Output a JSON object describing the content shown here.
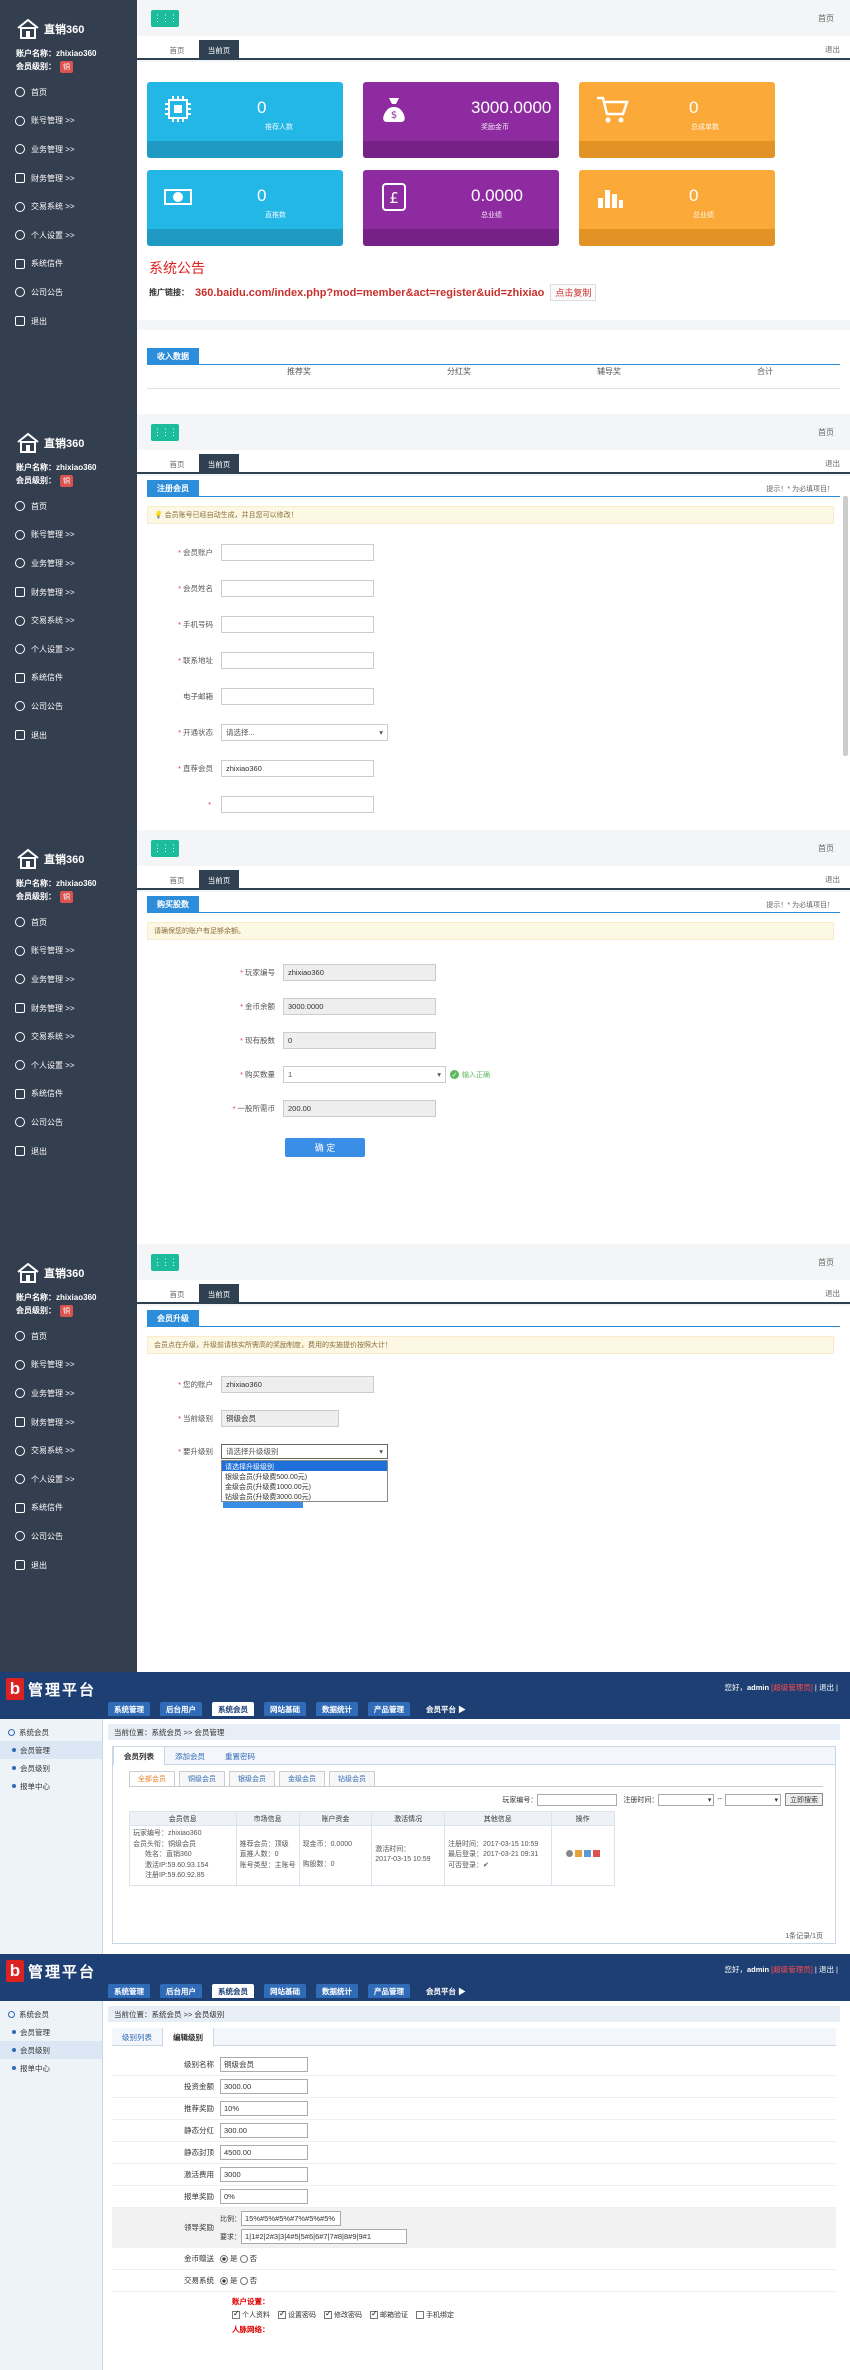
{
  "app": {
    "logo_text": "直销360",
    "account_label": "账户名称：",
    "account_value": "zhixiao360",
    "level_label": "会员级别：",
    "level_badge": "铜",
    "menu": [
      "首页",
      "账号管理 >>",
      "业务管理 >>",
      "财务管理 >>",
      "交易系统 >>",
      "个人设置 >>",
      "系统信件",
      "公司公告",
      "退出"
    ],
    "toggle_icon": "⋮⋮⋮",
    "home_link": "首页",
    "tab_home": "首页",
    "tab_current": "当前页",
    "close_link": "退出"
  },
  "dashboard": {
    "cards": [
      {
        "value": "0",
        "label": "推荐人数",
        "icon": "chip-icon",
        "color": "#23b7e5"
      },
      {
        "value": "3000.0000",
        "label": "奖励金币",
        "icon": "money-bag-icon",
        "color": "#8e2ba1"
      },
      {
        "value": "0",
        "label": "总成单数",
        "icon": "cart-icon",
        "color": "#fbaa3a"
      },
      {
        "value": "0",
        "label": "直推数",
        "icon": "world-money-icon",
        "color": "#23b7e5"
      },
      {
        "value": "0.0000",
        "label": "总业绩",
        "icon": "pound-icon",
        "color": "#8e2ba1"
      },
      {
        "value": "0",
        "label": "总业绩",
        "icon": "bar-chart-icon",
        "color": "#fbaa3a"
      }
    ],
    "announcement_title": "系统公告",
    "promo_label": "推广链接：",
    "promo_url": "360.baidu.com/index.php?mod=member&act=register&uid=zhixiao",
    "copy_button": "点击复制",
    "income_title": "收入数据",
    "income_columns": [
      "推荐奖",
      "分红奖",
      "辅导奖",
      "合计"
    ]
  },
  "register": {
    "section_title": "注册会员",
    "crumb": "提示！* 为必填项目！",
    "notice": "💡 会员账号已经自动生成，并且您可以修改！",
    "fields": [
      {
        "label": "会员账户",
        "required": true,
        "value": ""
      },
      {
        "label": "会员姓名",
        "required": true,
        "value": ""
      },
      {
        "label": "手机号码",
        "required": true,
        "value": ""
      },
      {
        "label": "联系地址",
        "required": true,
        "value": ""
      },
      {
        "label": "电子邮箱",
        "required": false,
        "value": ""
      },
      {
        "label": "开通状态",
        "required": true,
        "value": "请选择..."
      },
      {
        "label": "直荐会员",
        "required": true,
        "value": "zhixiao360"
      }
    ]
  },
  "purchase": {
    "section_title": "购买股数",
    "crumb": "提示！* 为必填项目！",
    "notice": "请确保您的账户有足够余额。",
    "fields": [
      {
        "label": "玩家编号",
        "value": "zhixiao360"
      },
      {
        "label": "金币余额",
        "value": "3000.0000"
      },
      {
        "label": "现有股数",
        "value": "0"
      },
      {
        "label": "购买数量",
        "value": "1"
      },
      {
        "label": "一股所需币",
        "value": "200.00"
      }
    ],
    "hint": "输入正确",
    "confirm_button": "确  定"
  },
  "upgrade": {
    "section_title": "会员升级",
    "notice": "会员点在升级，升级前请核实所需高的奖励制度，费用的实施提价按照大计！",
    "fields": [
      {
        "label": "您的账户",
        "value": "zhixiao360"
      },
      {
        "label": "当前级别",
        "value": "铜级会员"
      },
      {
        "label": "要升级别",
        "value": "请选择升级级别"
      }
    ],
    "options": [
      "请选择升级级别",
      "银级会员(升级费500.00元)",
      "金级会员(升级费1000.00元)",
      "钻级会员(升级费3000.00元)"
    ]
  },
  "admin": {
    "logo_b": "b",
    "logo_text": "管理平台",
    "user_greeting": "您好，",
    "user_name": "admin",
    "user_role": "[超级管理员]",
    "user_links": "| 退出 |",
    "nav": [
      "系统管理",
      "后台用户",
      "系统会员",
      "网站基础",
      "数据统计",
      "产品管理",
      "会员平台 ▶"
    ],
    "side": [
      "系统会员",
      "会员管理",
      "会员级别",
      "报单中心"
    ],
    "crumb_list": "当前位置：系统会员 >> 会员管理",
    "crumb_edit": "当前位置：系统会员 >> 会员级别",
    "list_tabs": [
      "会员列表",
      "添加会员",
      "重置密码"
    ],
    "level_tabs": [
      "全部会员",
      "铜级会员",
      "银级会员",
      "金级会员",
      "钻级会员"
    ],
    "search_label": "玩家编号：",
    "reg_time_label": "注册时间：",
    "search_button": "立即搜索",
    "table_headers": [
      "会员信息",
      "市场信息",
      "账户资金",
      "激活情况",
      "其他信息",
      "操作"
    ],
    "row": {
      "member": [
        "玩家编号：zhixiao360",
        "会员头衔：铜级会员",
        "姓名：直销360",
        "激活IP:59.60.93.154",
        "注册IP:59.60.92.85"
      ],
      "market": [
        "推荐会员：顶级",
        "直推人数：0",
        "账号类型：主账号"
      ],
      "funds": [
        "现金币：0.0000",
        "",
        "购股数：0"
      ],
      "activation": [
        "激活时间：",
        "2017-03-15 10:59"
      ],
      "other": [
        "注册时间：2017-03-15 10:59",
        "最后登录：2017-03-21 09:31",
        "可否登录：✔"
      ]
    },
    "record_count": "1条记录/1页",
    "edit_tabs": [
      "级别列表",
      "编辑级别"
    ],
    "edit_fields": [
      {
        "label": "级别名称",
        "value": "铜级会员"
      },
      {
        "label": "投资金额",
        "value": "3000.00"
      },
      {
        "label": "推荐奖励",
        "value": "10%"
      },
      {
        "label": "静态分红",
        "value": "300.00"
      },
      {
        "label": "静态封顶",
        "value": "4500.00"
      },
      {
        "label": "激活费用",
        "value": "3000"
      },
      {
        "label": "报单奖励",
        "value": "0%"
      }
    ],
    "lead_label": "领导奖励",
    "lead_ratio_label": "比例：",
    "lead_ratio_value": "15%#5%#5%#7%#5%#5%",
    "lead_req_label": "要求：",
    "lead_req_value": "1|1#2|2#3|3|4#5|5#6|6#7|7#8|8#9|9#1",
    "gold_label": "金币赠送",
    "trade_label": "交易系统",
    "yes": "是",
    "no": "否",
    "account_settings": "账户设置：",
    "checks": [
      "个人资料",
      "设置密码",
      "修改密码",
      "邮箱验证",
      "手机绑定"
    ],
    "network_label": "人脉网络："
  }
}
